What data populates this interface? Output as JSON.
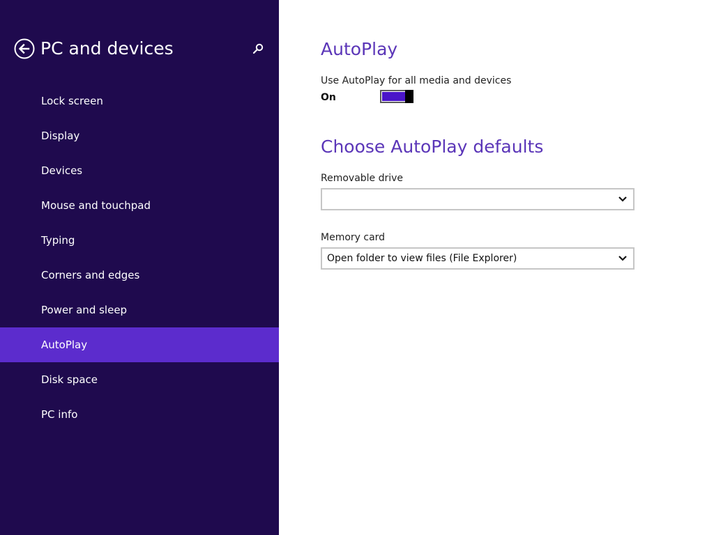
{
  "sidebar": {
    "title": "PC and devices",
    "back_icon": "back-arrow-circle-icon",
    "search_icon": "search-icon",
    "items": [
      {
        "label": "Lock screen",
        "selected": false
      },
      {
        "label": "Display",
        "selected": false
      },
      {
        "label": "Devices",
        "selected": false
      },
      {
        "label": "Mouse and touchpad",
        "selected": false
      },
      {
        "label": "Typing",
        "selected": false
      },
      {
        "label": "Corners and edges",
        "selected": false
      },
      {
        "label": "Power and sleep",
        "selected": false
      },
      {
        "label": "AutoPlay",
        "selected": true
      },
      {
        "label": "Disk space",
        "selected": false
      },
      {
        "label": "PC info",
        "selected": false
      }
    ]
  },
  "main": {
    "autoplay": {
      "title": "AutoPlay",
      "toggle_label": "Use AutoPlay for all media and devices",
      "toggle_state": "On",
      "toggle_on": true
    },
    "defaults": {
      "title": "Choose AutoPlay defaults",
      "removable_drive": {
        "label": "Removable drive",
        "value": ""
      },
      "memory_card": {
        "label": "Memory card",
        "value": "Open folder to view files (File Explorer)"
      }
    }
  },
  "colors": {
    "sidebar_bg": "#1f0a4e",
    "selected_item_bg": "#5c2ccd",
    "accent": "#5b36b8",
    "toggle_fill": "#4a15c9"
  }
}
